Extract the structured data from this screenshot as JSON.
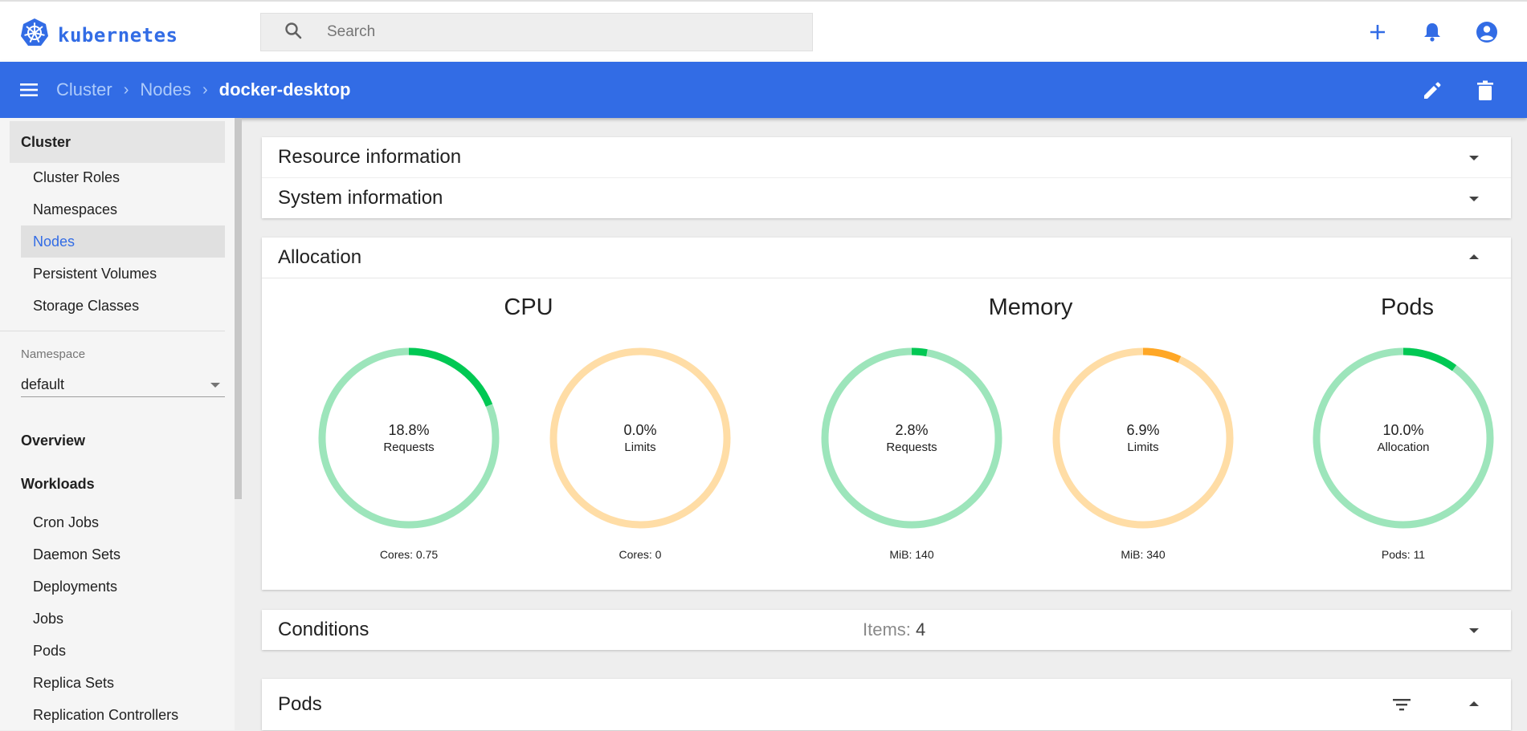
{
  "app": {
    "name": "kubernetes"
  },
  "search": {
    "placeholder": "Search"
  },
  "breadcrumb": {
    "items": [
      "Cluster",
      "Nodes"
    ],
    "current": "docker-desktop"
  },
  "sidebar": {
    "cluster_section": "Cluster",
    "cluster_items": [
      {
        "label": "Cluster Roles",
        "active": false
      },
      {
        "label": "Namespaces",
        "active": false
      },
      {
        "label": "Nodes",
        "active": true
      },
      {
        "label": "Persistent Volumes",
        "active": false
      },
      {
        "label": "Storage Classes",
        "active": false
      }
    ],
    "namespace_label": "Namespace",
    "namespace_value": "default",
    "overview": "Overview",
    "workloads": "Workloads",
    "workload_items": [
      "Cron Jobs",
      "Daemon Sets",
      "Deployments",
      "Jobs",
      "Pods",
      "Replica Sets",
      "Replication Controllers"
    ]
  },
  "cards": {
    "resource_information": "Resource information",
    "system_information": "System information",
    "allocation": "Allocation",
    "conditions": {
      "title": "Conditions",
      "items_label": "Items:",
      "items_count": "4"
    },
    "pods": "Pods"
  },
  "allocation": {
    "groups": [
      "CPU",
      "Memory",
      "Pods"
    ],
    "gauges": [
      {
        "percent_text": "18.8%",
        "fraction": 0.188,
        "label": "Requests",
        "footer": "Cores: 0.75",
        "theme": "green"
      },
      {
        "percent_text": "0.0%",
        "fraction": 0.0,
        "label": "Limits",
        "footer": "Cores: 0",
        "theme": "orange"
      },
      {
        "percent_text": "2.8%",
        "fraction": 0.028,
        "label": "Requests",
        "footer": "MiB: 140",
        "theme": "green"
      },
      {
        "percent_text": "6.9%",
        "fraction": 0.069,
        "label": "Limits",
        "footer": "MiB: 340",
        "theme": "orange"
      },
      {
        "percent_text": "10.0%",
        "fraction": 0.1,
        "label": "Allocation",
        "footer": "Pods: 11",
        "theme": "green"
      }
    ]
  },
  "colors": {
    "brand": "#326ce5",
    "green_track": "#9de5bb",
    "green_fill": "#00c853",
    "orange_track": "#ffdda6",
    "orange_fill": "#ffa726"
  },
  "icons": [
    "kubernetes-logo-icon",
    "search-icon",
    "add-icon",
    "bell-icon",
    "account-icon",
    "menu-icon",
    "chevron-right-icon",
    "edit-icon",
    "delete-icon",
    "dropdown-arrow-icon",
    "filter-icon"
  ]
}
